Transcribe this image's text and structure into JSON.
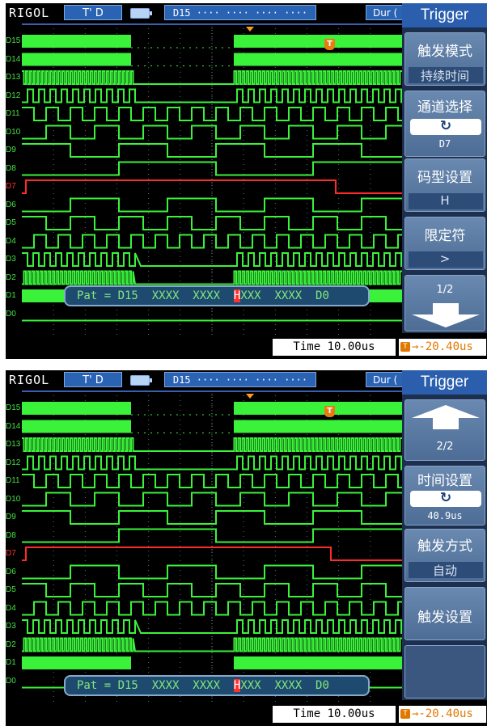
{
  "brand": "RIGOL",
  "trigger_status": "T' D",
  "pattern_status": "D15 ···· ···· ···· ····  D0",
  "dur_label": "Dur (",
  "channels": [
    "D15",
    "D14",
    "D13",
    "D12",
    "D11",
    "D10",
    "D9",
    "D8",
    "D7",
    "D6",
    "D5",
    "D4",
    "D3",
    "D2",
    "D1",
    "D0"
  ],
  "pattern_prefix": "Pat = D15  XXXX  XXXX  ",
  "pattern_highlight": "H",
  "pattern_suffix": "XXX  XXXX  D0",
  "time_readout": "Time  10.00us",
  "trigger_offset": "→-20.40us",
  "trigger_marker": "T",
  "colors": {
    "waveform": "#3af23a",
    "channel_d7": "#ff2a2a",
    "menu_title_bg": "#2b5fae",
    "offset": "#e07800"
  },
  "screen1": {
    "menu_title": "Trigger",
    "items": [
      {
        "label": "触发模式",
        "value": "持续时间"
      },
      {
        "label": "通道选择",
        "value": "D7"
      },
      {
        "label": "码型设置",
        "value": "H"
      },
      {
        "label": "限定符",
        "value": ">"
      }
    ],
    "page": "1/2",
    "nav_icon": "arrow-down-icon"
  },
  "screen2": {
    "menu_title": "Trigger",
    "page": "2/2",
    "nav_icon": "arrow-up-icon",
    "items": [
      {
        "label": "时间设置",
        "value": "40.9us"
      },
      {
        "label": "触发方式",
        "value": "自动"
      },
      {
        "label": "触发设置"
      }
    ]
  }
}
